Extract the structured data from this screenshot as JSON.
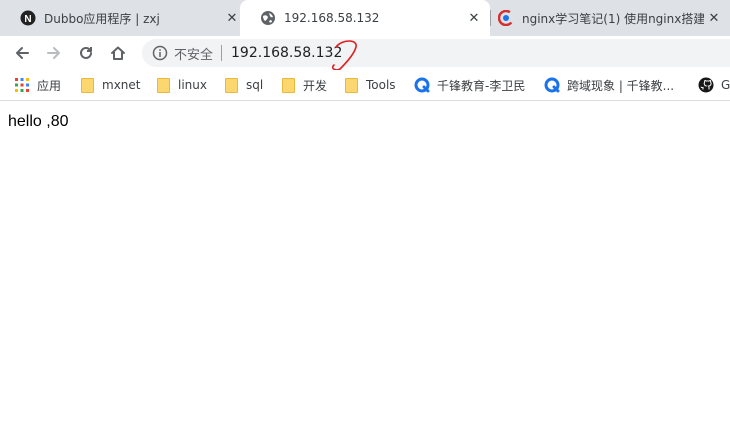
{
  "tabs": [
    {
      "title": "Dubbo应用程序 | zxj",
      "favicon": "notion-n-icon",
      "active": false
    },
    {
      "title": "192.168.58.132",
      "favicon": "globe-icon",
      "active": true
    },
    {
      "title": "nginx学习笔记(1) 使用nginx搭建",
      "favicon": "csdn-c-icon",
      "active": false
    }
  ],
  "toolbar": {
    "security_label": "不安全",
    "url": "192.168.58.132"
  },
  "bookmarks": [
    {
      "label": "应用",
      "icon": "apps-grid-icon"
    },
    {
      "label": "mxnet",
      "icon": "folder-icon"
    },
    {
      "label": "linux",
      "icon": "folder-icon"
    },
    {
      "label": "sql",
      "icon": "folder-icon"
    },
    {
      "label": "开发",
      "icon": "folder-icon"
    },
    {
      "label": "Tools",
      "icon": "folder-icon"
    },
    {
      "label": "千锋教育-李卫民",
      "icon": "qianfeng-icon"
    },
    {
      "label": "跨域现象 | 千锋教...",
      "icon": "qianfeng-icon"
    },
    {
      "label": "G",
      "icon": "github-icon"
    }
  ],
  "page": {
    "body_text": "hello ,80"
  },
  "colors": {
    "tabstrip_bg": "#dee1e6",
    "omnibox_bg": "#f1f3f4",
    "annotation_red": "#e02020",
    "folder_yellow": "#fcd770",
    "qianfeng_blue": "#1a73e8"
  }
}
